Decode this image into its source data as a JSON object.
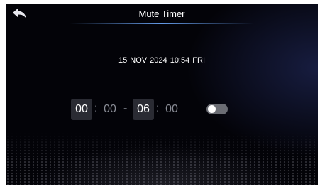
{
  "header": {
    "title": "Mute Timer",
    "back_icon": "back-arrow-icon"
  },
  "datetime": {
    "text": "15 NOV 2024  10:54 FRI"
  },
  "timer": {
    "start_hour": "00",
    "start_minute": "00",
    "range_separator": "-",
    "end_hour": "06",
    "end_minute": "00",
    "time_separator": ":"
  },
  "toggle": {
    "state": "off"
  },
  "colors": {
    "background": "#030308",
    "title_glow": "#6eaaff",
    "time_box": "#2a2b33",
    "toggle_off": "#6b6d74"
  }
}
